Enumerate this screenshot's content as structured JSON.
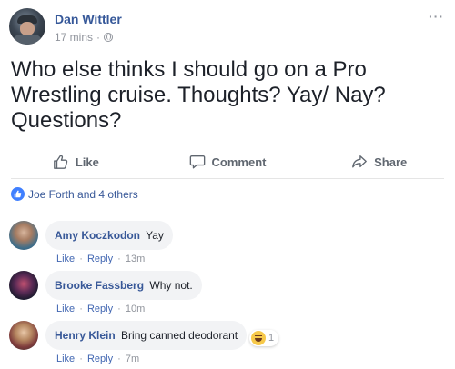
{
  "post": {
    "author": "Dan Wittler",
    "time": "17 mins",
    "separator": "·",
    "more": "···",
    "text": "Who else thinks I should go on a Pro Wrestling cruise. Thoughts? Yay/ Nay? Questions?"
  },
  "actions": {
    "like": "Like",
    "comment": "Comment",
    "share": "Share"
  },
  "reactions": {
    "text": "Joe Forth and 4 others"
  },
  "comments": [
    {
      "name": "Amy Koczkodon",
      "text": "Yay",
      "like": "Like",
      "reply": "Reply",
      "sep": "·",
      "time": "13m"
    },
    {
      "name": "Brooke Fassberg",
      "text": "Why not.",
      "like": "Like",
      "reply": "Reply",
      "sep": "·",
      "time": "10m"
    },
    {
      "name": "Henry Klein",
      "text": "Bring canned deodorant",
      "like": "Like",
      "reply": "Reply",
      "sep": "·",
      "time": "7m",
      "reaction_count": "1"
    }
  ],
  "colors": {
    "link_blue": "#365899",
    "accent": "#4080ff",
    "muted": "#90949c",
    "bubble": "#f2f3f5"
  }
}
